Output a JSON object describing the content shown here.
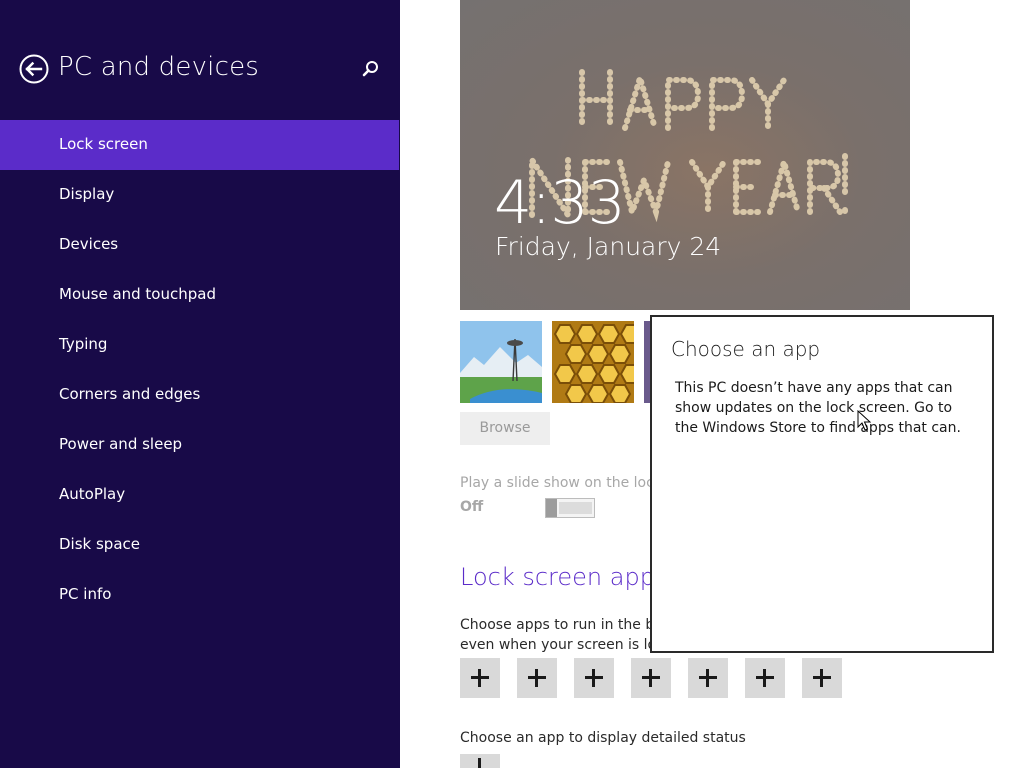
{
  "sidebar": {
    "title": "PC and devices",
    "back_icon": "back-arrow-icon",
    "search_icon": "search-icon",
    "items": [
      {
        "label": "Lock screen",
        "active": true
      },
      {
        "label": "Display",
        "active": false
      },
      {
        "label": "Devices",
        "active": false
      },
      {
        "label": "Mouse and touchpad",
        "active": false
      },
      {
        "label": "Typing",
        "active": false
      },
      {
        "label": "Corners and edges",
        "active": false
      },
      {
        "label": "Power and sleep",
        "active": false
      },
      {
        "label": "AutoPlay",
        "active": false
      },
      {
        "label": "Disk space",
        "active": false
      },
      {
        "label": "PC info",
        "active": false
      }
    ]
  },
  "lock_preview": {
    "image_text": "Happy New Year!",
    "time": "4:33",
    "date": "Friday, January 24"
  },
  "background": {
    "browse_label": "Browse"
  },
  "slideshow": {
    "label": "Play a slide show on the lock s",
    "state": "Off"
  },
  "lock_apps": {
    "heading": "Lock screen apps",
    "description_line1": "Choose apps to run in the bac",
    "description_line2": "even when your screen is locke",
    "add_button_count": 7,
    "detail_label": "Choose an app to display detailed status"
  },
  "flyout": {
    "title": "Choose an app",
    "message": "This PC doesn’t have any apps that can show updates on the lock screen. Go to the Windows Store to find apps that can."
  },
  "colors": {
    "sidebar_bg": "#180a48",
    "accent": "#5b2cc9",
    "heading": "#5b2cc9"
  }
}
